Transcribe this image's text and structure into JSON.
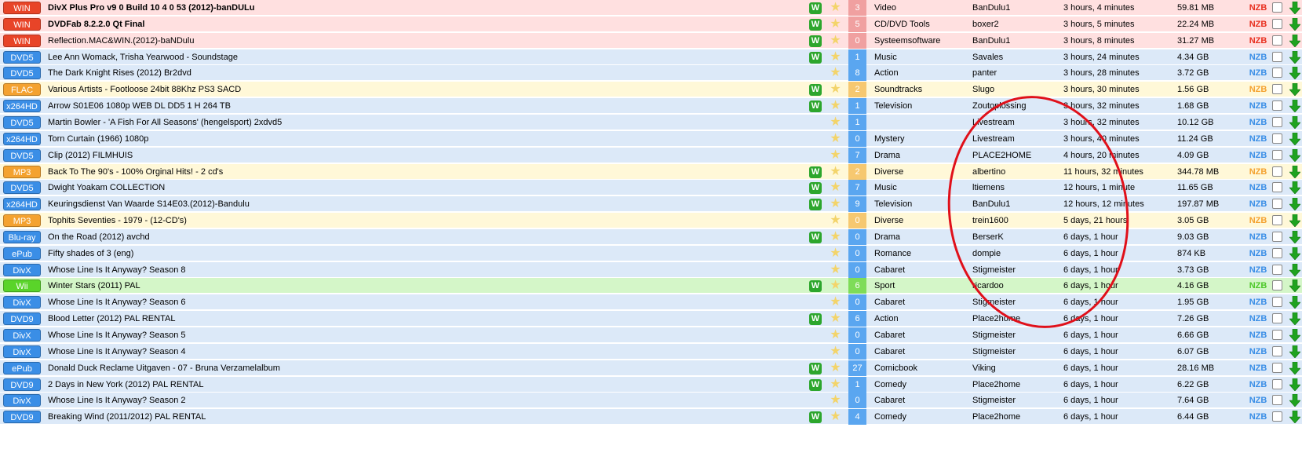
{
  "row_types": {
    "win": {
      "bg": "#ffe0e0",
      "tag": "#e84428",
      "nzb": "#e83020",
      "count": "#f0a0a0"
    },
    "blue": {
      "bg": "#dce9f8",
      "tag": "#3a8ee6",
      "nzb": "#3a8ee6",
      "count": "#5aa6f0"
    },
    "yellow": {
      "bg": "#fff8d8",
      "tag": "#f4a230",
      "nzb": "#f4a230",
      "count": "#f6c870"
    },
    "green": {
      "bg": "#d4f6c8",
      "tag": "#5ad42a",
      "nzb": "#4ec82a",
      "count": "#7edc58"
    }
  },
  "rows": [
    {
      "type": "win",
      "tag": "WIN",
      "title": "DivX Plus Pro v9 0 Build 10 4 0 53 (2012)-banDULu",
      "bold": true,
      "w": true,
      "count": "3",
      "category": "Video",
      "poster": "BanDulu1",
      "age": "3 hours, 4 minutes",
      "size": "59.81 MB",
      "nzb": "NZB"
    },
    {
      "type": "win",
      "tag": "WIN",
      "title": "DVDFab 8.2.2.0 Qt Final",
      "bold": true,
      "w": true,
      "count": "5",
      "category": "CD/DVD Tools",
      "poster": "boxer2",
      "age": "3 hours, 5 minutes",
      "size": "22.24 MB",
      "nzb": "NZB"
    },
    {
      "type": "win",
      "tag": "WIN",
      "title": "Reflection.MAC&WIN.(2012)-baNDulu",
      "bold": false,
      "w": true,
      "count": "0",
      "category": "Systeemsoftware",
      "poster": "BanDulu1",
      "age": "3 hours, 8 minutes",
      "size": "31.27 MB",
      "nzb": "NZB"
    },
    {
      "type": "blue",
      "tag": "DVD5",
      "title": "Lee Ann Womack, Trisha Yearwood - Soundstage",
      "bold": false,
      "w": true,
      "count": "1",
      "category": "Music",
      "poster": "Savales",
      "age": "3 hours, 24 minutes",
      "size": "4.34 GB",
      "nzb": "NZB"
    },
    {
      "type": "blue",
      "tag": "DVD5",
      "title": "The Dark Knight Rises (2012) Br2dvd",
      "bold": false,
      "w": false,
      "count": "8",
      "category": "Action",
      "poster": "panter",
      "age": "3 hours, 28 minutes",
      "size": "3.72 GB",
      "nzb": "NZB"
    },
    {
      "type": "yellow",
      "tag": "FLAC",
      "title": "Various Artists - Footloose 24bit 88Khz PS3 SACD",
      "bold": false,
      "w": true,
      "count": "2",
      "category": "Soundtracks",
      "poster": "Slugo",
      "age": "3 hours, 30 minutes",
      "size": "1.56 GB",
      "nzb": "NZB"
    },
    {
      "type": "blue",
      "tag": "x264HD",
      "title": "Arrow S01E06 1080p WEB DL DD5 1 H 264 TB",
      "bold": false,
      "w": true,
      "count": "1",
      "category": "Television",
      "poster": "Zoutoplossing",
      "age": "3 hours, 32 minutes",
      "size": "1.68 GB",
      "nzb": "NZB"
    },
    {
      "type": "blue",
      "tag": "DVD5",
      "title": "Martin Bowler - 'A Fish For All Seasons' (hengelsport) 2xdvd5",
      "bold": false,
      "w": false,
      "count": "1",
      "category": "",
      "poster": "Livestream",
      "age": "3 hours, 32 minutes",
      "size": "10.12 GB",
      "nzb": "NZB"
    },
    {
      "type": "blue",
      "tag": "x264HD",
      "title": "Torn Curtain (1966) 1080p",
      "bold": false,
      "w": false,
      "count": "0",
      "category": "Mystery",
      "poster": "Livestream",
      "age": "3 hours, 40 minutes",
      "size": "11.24 GB",
      "nzb": "NZB"
    },
    {
      "type": "blue",
      "tag": "DVD5",
      "title": "Clip (2012) FILMHUIS",
      "bold": false,
      "w": false,
      "count": "7",
      "category": "Drama",
      "poster": "PLACE2HOME",
      "age": "4 hours, 20 minutes",
      "size": "4.09 GB",
      "nzb": "NZB"
    },
    {
      "type": "yellow",
      "tag": "MP3",
      "title": "Back To The 90's - 100% Orginal Hits! - 2 cd's",
      "bold": false,
      "w": true,
      "count": "2",
      "category": "Diverse",
      "poster": "albertino",
      "age": "11 hours, 32 minutes",
      "size": "344.78 MB",
      "nzb": "NZB"
    },
    {
      "type": "blue",
      "tag": "DVD5",
      "title": "Dwight Yoakam COLLECTION",
      "bold": false,
      "w": true,
      "count": "7",
      "category": "Music",
      "poster": "ltiemens",
      "age": "12 hours, 1 minute",
      "size": "11.65 GB",
      "nzb": "NZB"
    },
    {
      "type": "blue",
      "tag": "x264HD",
      "title": "Keuringsdienst Van Waarde S14E03.(2012)-Bandulu",
      "bold": false,
      "w": true,
      "count": "9",
      "category": "Television",
      "poster": "BanDulu1",
      "age": "12 hours, 12 minutes",
      "size": "197.87 MB",
      "nzb": "NZB"
    },
    {
      "type": "yellow",
      "tag": "MP3",
      "title": "Tophits Seventies - 1979 - (12-CD's)",
      "bold": false,
      "w": false,
      "count": "0",
      "category": "Diverse",
      "poster": "trein1600",
      "age": "5 days, 21 hours",
      "size": "3.05 GB",
      "nzb": "NZB"
    },
    {
      "type": "blue",
      "tag": "Blu-ray",
      "title": "On the Road (2012) avchd",
      "bold": false,
      "w": true,
      "count": "0",
      "category": "Drama",
      "poster": "BerserK",
      "age": "6 days, 1 hour",
      "size": "9.03 GB",
      "nzb": "NZB"
    },
    {
      "type": "blue",
      "tag": "ePub",
      "title": "Fifty shades of 3 (eng)",
      "bold": false,
      "w": false,
      "count": "0",
      "category": "Romance",
      "poster": "dompie",
      "age": "6 days, 1 hour",
      "size": "874 KB",
      "nzb": "NZB"
    },
    {
      "type": "blue",
      "tag": "DivX",
      "title": "Whose Line Is It Anyway? Season 8",
      "bold": false,
      "w": false,
      "count": "0",
      "category": "Cabaret",
      "poster": "Stigmeister",
      "age": "6 days, 1 hour",
      "size": "3.73 GB",
      "nzb": "NZB"
    },
    {
      "type": "green",
      "tag": "Wii",
      "title": "Winter Stars (2011) PAL",
      "bold": false,
      "w": true,
      "count": "6",
      "category": "Sport",
      "poster": "ricardoo",
      "age": "6 days, 1 hour",
      "size": "4.16 GB",
      "nzb": "NZB"
    },
    {
      "type": "blue",
      "tag": "DivX",
      "title": "Whose Line Is It Anyway? Season 6",
      "bold": false,
      "w": false,
      "count": "0",
      "category": "Cabaret",
      "poster": "Stigmeister",
      "age": "6 days, 1 hour",
      "size": "1.95 GB",
      "nzb": "NZB"
    },
    {
      "type": "blue",
      "tag": "DVD9",
      "title": "Blood Letter (2012) PAL RENTAL",
      "bold": false,
      "w": true,
      "count": "6",
      "category": "Action",
      "poster": "Place2home",
      "age": "6 days, 1 hour",
      "size": "7.26 GB",
      "nzb": "NZB"
    },
    {
      "type": "blue",
      "tag": "DivX",
      "title": "Whose Line Is It Anyway? Season 5",
      "bold": false,
      "w": false,
      "count": "0",
      "category": "Cabaret",
      "poster": "Stigmeister",
      "age": "6 days, 1 hour",
      "size": "6.66 GB",
      "nzb": "NZB"
    },
    {
      "type": "blue",
      "tag": "DivX",
      "title": "Whose Line Is It Anyway? Season 4",
      "bold": false,
      "w": false,
      "count": "0",
      "category": "Cabaret",
      "poster": "Stigmeister",
      "age": "6 days, 1 hour",
      "size": "6.07 GB",
      "nzb": "NZB"
    },
    {
      "type": "blue",
      "tag": "ePub",
      "title": "Donald Duck Reclame Uitgaven - 07 - Bruna Verzamelalbum",
      "bold": false,
      "w": true,
      "count": "27",
      "category": "Comicbook",
      "poster": "Viking",
      "age": "6 days, 1 hour",
      "size": "28.16 MB",
      "nzb": "NZB"
    },
    {
      "type": "blue",
      "tag": "DVD9",
      "title": "2 Days in New York (2012) PAL RENTAL",
      "bold": false,
      "w": true,
      "count": "1",
      "category": "Comedy",
      "poster": "Place2home",
      "age": "6 days, 1 hour",
      "size": "6.22 GB",
      "nzb": "NZB"
    },
    {
      "type": "blue",
      "tag": "DivX",
      "title": "Whose Line Is It Anyway? Season 2",
      "bold": false,
      "w": false,
      "count": "0",
      "category": "Cabaret",
      "poster": "Stigmeister",
      "age": "6 days, 1 hour",
      "size": "7.64 GB",
      "nzb": "NZB"
    },
    {
      "type": "blue",
      "tag": "DVD9",
      "title": "Breaking Wind (2011/2012) PAL RENTAL",
      "bold": false,
      "w": true,
      "count": "4",
      "category": "Comedy",
      "poster": "Place2home",
      "age": "6 days, 1 hour",
      "size": "6.44 GB",
      "nzb": "NZB"
    }
  ],
  "labels": {
    "w_badge": "W",
    "star_glyph": "★"
  },
  "annotation": {
    "color": "#e0101a"
  }
}
